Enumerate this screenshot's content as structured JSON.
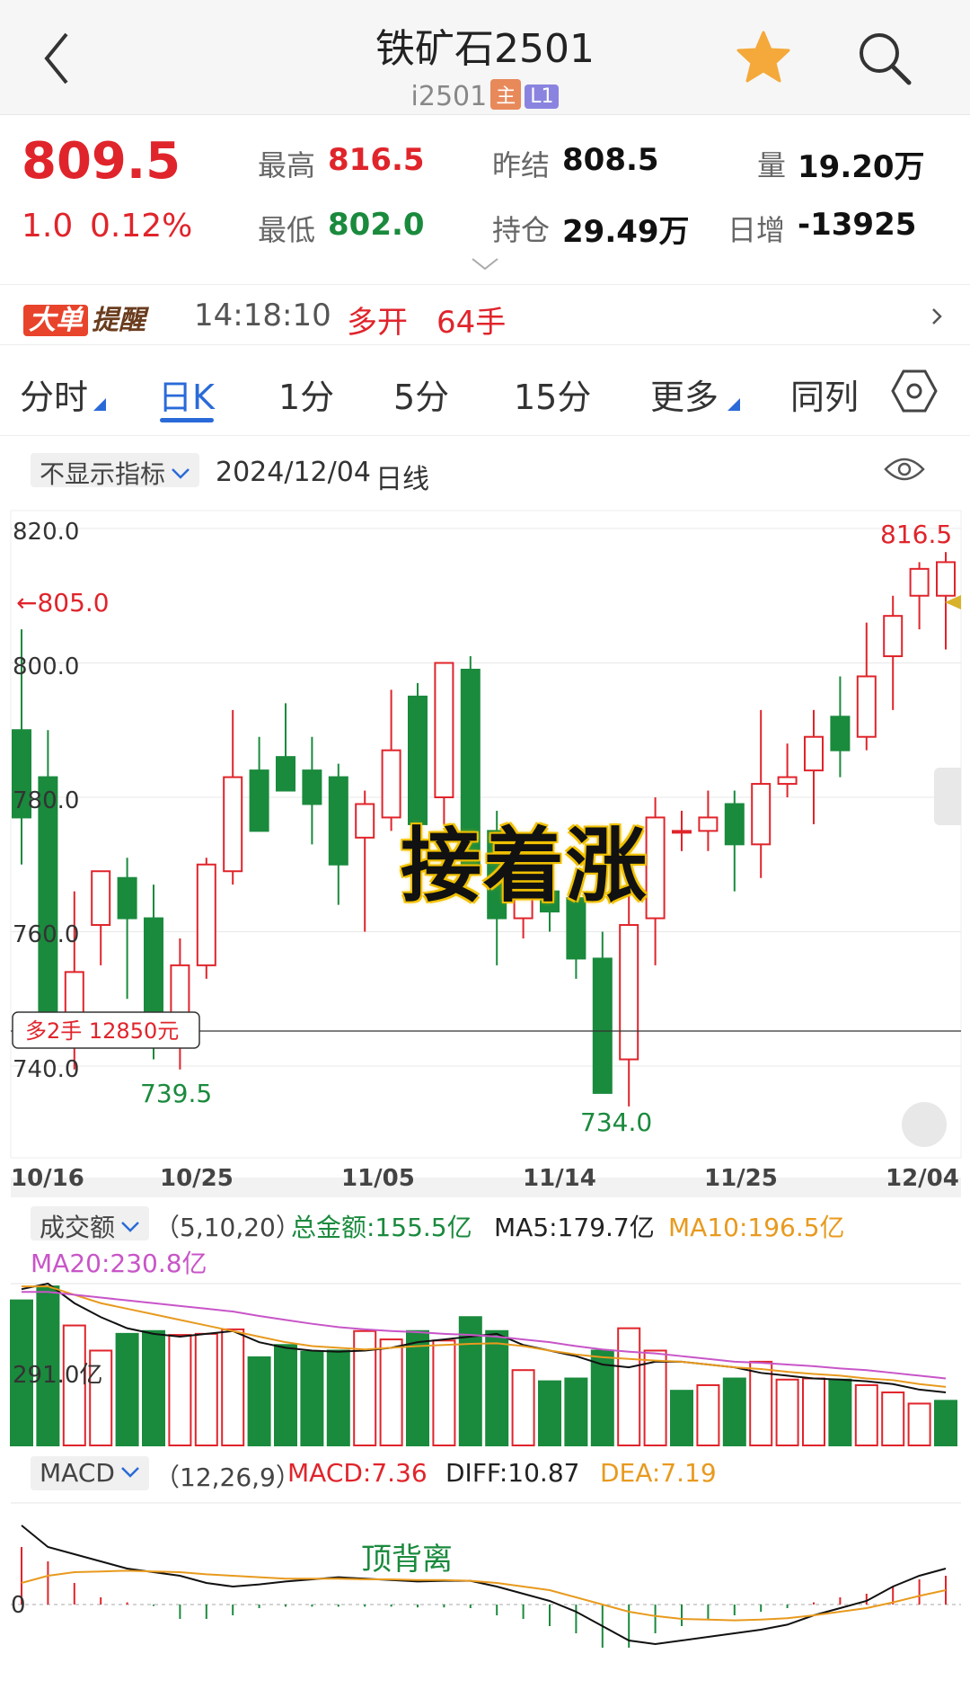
{
  "header": {
    "title": "铁矿石2501",
    "code": "i2501",
    "badge_main": "主",
    "badge_level": "L1"
  },
  "quote": {
    "price": "809.5",
    "change": "1.0",
    "change_pct": "0.12%",
    "high_label": "最高",
    "high": "816.5",
    "low_label": "最低",
    "low": "802.0",
    "prev_label": "昨结",
    "prev": "808.5",
    "oi_label": "持仓",
    "oi": "29.49万",
    "vol_label": "量",
    "vol": "19.20万",
    "daily_inc_label": "日增",
    "daily_inc": "-13925"
  },
  "alert": {
    "tag_big": "大单",
    "tag_tip": "提醒",
    "time": "14:18:10",
    "action": "多开",
    "volume": "64手"
  },
  "tabs": [
    "分时",
    "日K",
    "1分",
    "5分",
    "15分",
    "更多",
    "同列"
  ],
  "indicator_bar": {
    "selector": "不显示指标",
    "date": "2024/12/04",
    "period": "日线"
  },
  "kline_labels": {
    "y_ticks": [
      "820.0",
      "800.0",
      "780.0",
      "760.0",
      "740.0"
    ],
    "high_marker": "816.5",
    "low_marker_1": "739.5",
    "low_marker_2": "734.0",
    "ref_marker": "←805.0",
    "position_tag": "多2手 12850元",
    "overlay": "接着涨",
    "dates": [
      "10/16",
      "10/25",
      "11/05",
      "11/14",
      "11/25",
      "12/04"
    ]
  },
  "volume_panel": {
    "selector": "成交额",
    "params": "（5,10,20）",
    "total": "总金额:155.5亿",
    "ma5": "MA5:179.7亿",
    "ma10": "MA10:196.5亿",
    "ma20": "MA20:230.8亿",
    "axis_label": "291.0亿"
  },
  "macd_panel": {
    "selector": "MACD",
    "params": "（12,26,9）",
    "macd": "MACD:7.36",
    "diff": "DIFF:10.87",
    "dea": "DEA:7.19",
    "zero": "0",
    "annotation": "顶背离"
  },
  "colors": {
    "up": "#e0242b",
    "down": "#1a8a3d",
    "accent": "#2a6ad8",
    "ma10": "#e89a1e",
    "ma20": "#c855c8"
  },
  "chart_data": {
    "type": "candlestick",
    "ylim": [
      731,
      825
    ],
    "candles": [
      {
        "o": 790,
        "h": 805,
        "l": 770,
        "c": 777
      },
      {
        "o": 783,
        "h": 790,
        "l": 745,
        "c": 745
      },
      {
        "o": 746,
        "h": 766,
        "l": 739.5,
        "c": 754
      },
      {
        "o": 761,
        "h": 768,
        "l": 755,
        "c": 769
      },
      {
        "o": 768,
        "h": 771,
        "l": 750,
        "c": 762
      },
      {
        "o": 762,
        "h": 767,
        "l": 741,
        "c": 745
      },
      {
        "o": 745,
        "h": 759,
        "l": 739.5,
        "c": 755
      },
      {
        "o": 755,
        "h": 771,
        "l": 753,
        "c": 770
      },
      {
        "o": 769,
        "h": 793,
        "l": 767,
        "c": 783
      },
      {
        "o": 784,
        "h": 789,
        "l": 775,
        "c": 775
      },
      {
        "o": 786,
        "h": 794,
        "l": 782,
        "c": 781
      },
      {
        "o": 784,
        "h": 789,
        "l": 773,
        "c": 779
      },
      {
        "o": 783,
        "h": 785,
        "l": 764,
        "c": 770
      },
      {
        "o": 774,
        "h": 781,
        "l": 760,
        "c": 779
      },
      {
        "o": 777,
        "h": 796,
        "l": 775,
        "c": 787
      },
      {
        "o": 795,
        "h": 797,
        "l": 771,
        "c": 776
      },
      {
        "o": 780,
        "h": 800,
        "l": 776,
        "c": 800
      },
      {
        "o": 799,
        "h": 801,
        "l": 770,
        "c": 769
      },
      {
        "o": 775,
        "h": 778,
        "l": 755,
        "c": 762
      },
      {
        "o": 762,
        "h": 769,
        "l": 759,
        "c": 768
      },
      {
        "o": 766,
        "h": 769,
        "l": 760,
        "c": 763
      },
      {
        "o": 765,
        "h": 768,
        "l": 753,
        "c": 756
      },
      {
        "o": 756,
        "h": 760,
        "l": 736,
        "c": 736
      },
      {
        "o": 741,
        "h": 770,
        "l": 734,
        "c": 761
      },
      {
        "o": 762,
        "h": 780,
        "l": 755,
        "c": 777
      },
      {
        "o": 775,
        "h": 778,
        "l": 772,
        "c": 775
      },
      {
        "o": 775,
        "h": 781,
        "l": 772,
        "c": 777
      },
      {
        "o": 779,
        "h": 781,
        "l": 766,
        "c": 773
      },
      {
        "o": 773,
        "h": 793,
        "l": 768,
        "c": 782
      },
      {
        "o": 782,
        "h": 788,
        "l": 780,
        "c": 783
      },
      {
        "o": 784,
        "h": 793,
        "l": 776,
        "c": 789
      },
      {
        "o": 792,
        "h": 798,
        "l": 783,
        "c": 787
      },
      {
        "o": 789,
        "h": 806,
        "l": 787,
        "c": 798
      },
      {
        "o": 801,
        "h": 810,
        "l": 793,
        "c": 807
      },
      {
        "o": 810,
        "h": 815,
        "l": 805,
        "c": 814
      },
      {
        "o": 810,
        "h": 816.5,
        "l": 802,
        "c": 815
      }
    ],
    "volume": [
      {
        "v": 260,
        "up": false
      },
      {
        "v": 285,
        "up": false
      },
      {
        "v": 215,
        "up": true
      },
      {
        "v": 170,
        "up": true
      },
      {
        "v": 200,
        "up": false
      },
      {
        "v": 205,
        "up": false
      },
      {
        "v": 198,
        "up": true
      },
      {
        "v": 200,
        "up": true
      },
      {
        "v": 208,
        "up": true
      },
      {
        "v": 158,
        "up": false
      },
      {
        "v": 180,
        "up": false
      },
      {
        "v": 168,
        "up": false
      },
      {
        "v": 170,
        "up": false
      },
      {
        "v": 205,
        "up": true
      },
      {
        "v": 190,
        "up": true
      },
      {
        "v": 205,
        "up": false
      },
      {
        "v": 188,
        "up": true
      },
      {
        "v": 230,
        "up": false
      },
      {
        "v": 205,
        "up": false
      },
      {
        "v": 135,
        "up": true
      },
      {
        "v": 115,
        "up": false
      },
      {
        "v": 120,
        "up": false
      },
      {
        "v": 170,
        "up": false
      },
      {
        "v": 210,
        "up": true
      },
      {
        "v": 170,
        "up": true
      },
      {
        "v": 98,
        "up": false
      },
      {
        "v": 108,
        "up": true
      },
      {
        "v": 120,
        "up": false
      },
      {
        "v": 150,
        "up": true
      },
      {
        "v": 118,
        "up": true
      },
      {
        "v": 120,
        "up": true
      },
      {
        "v": 118,
        "up": false
      },
      {
        "v": 108,
        "up": true
      },
      {
        "v": 95,
        "up": true
      },
      {
        "v": 75,
        "up": true
      },
      {
        "v": 80,
        "up": false
      }
    ],
    "macd_hist": [
      8,
      6,
      3,
      1,
      0.3,
      -0.2,
      -2,
      -2,
      -1.5,
      -0.5,
      -0.3,
      -0.3,
      -0.3,
      -0.3,
      -0.3,
      -0.4,
      -0.4,
      -0.5,
      -1.5,
      -2,
      -3,
      -4,
      -6,
      -6,
      -4,
      -3,
      -2,
      -1.5,
      -1,
      -0.5,
      0.3,
      1,
      1.5,
      2.5,
      3.5,
      4
    ],
    "diff": [
      11,
      8,
      7,
      6,
      5,
      4.5,
      4,
      3,
      2.5,
      2.8,
      3.2,
      3.5,
      3.8,
      3.6,
      3.4,
      3.2,
      3.3,
      3.3,
      2.5,
      1.5,
      0.5,
      -1,
      -3,
      -5,
      -5.5,
      -5,
      -4.5,
      -4,
      -3.5,
      -2.8,
      -1.5,
      -0.5,
      0.5,
      2.5,
      4,
      5
    ],
    "dea": [
      3,
      4,
      4.5,
      4.6,
      4.7,
      4.6,
      4.5,
      4.2,
      4,
      3.8,
      3.6,
      3.6,
      3.6,
      3.5,
      3.5,
      3.4,
      3.4,
      3.3,
      3,
      2.5,
      2,
      1,
      0,
      -1,
      -1.6,
      -2,
      -2.1,
      -2.2,
      -2.1,
      -1.9,
      -1.5,
      -1,
      -0.5,
      0.3,
      1.2,
      2
    ],
    "vol_ma5": [
      280,
      290,
      255,
      230,
      210,
      200,
      195,
      200,
      205,
      185,
      175,
      170,
      168,
      170,
      175,
      185,
      190,
      195,
      200,
      180,
      170,
      160,
      145,
      140,
      150,
      150,
      145,
      140,
      130,
      125,
      120,
      118,
      115,
      110,
      100,
      95
    ],
    "vol_ma10": [
      285,
      285,
      270,
      255,
      245,
      235,
      225,
      215,
      205,
      195,
      185,
      178,
      175,
      172,
      175,
      178,
      180,
      182,
      183,
      178,
      170,
      163,
      158,
      155,
      152,
      150,
      145,
      140,
      137,
      132,
      128,
      125,
      120,
      117,
      110,
      105
    ],
    "vol_ma20": [
      275,
      275,
      270,
      265,
      260,
      255,
      250,
      245,
      240,
      232,
      225,
      218,
      212,
      208,
      205,
      203,
      200,
      198,
      195,
      190,
      185,
      178,
      172,
      168,
      165,
      160,
      155,
      150,
      148,
      145,
      142,
      138,
      135,
      130,
      125,
      120
    ]
  }
}
